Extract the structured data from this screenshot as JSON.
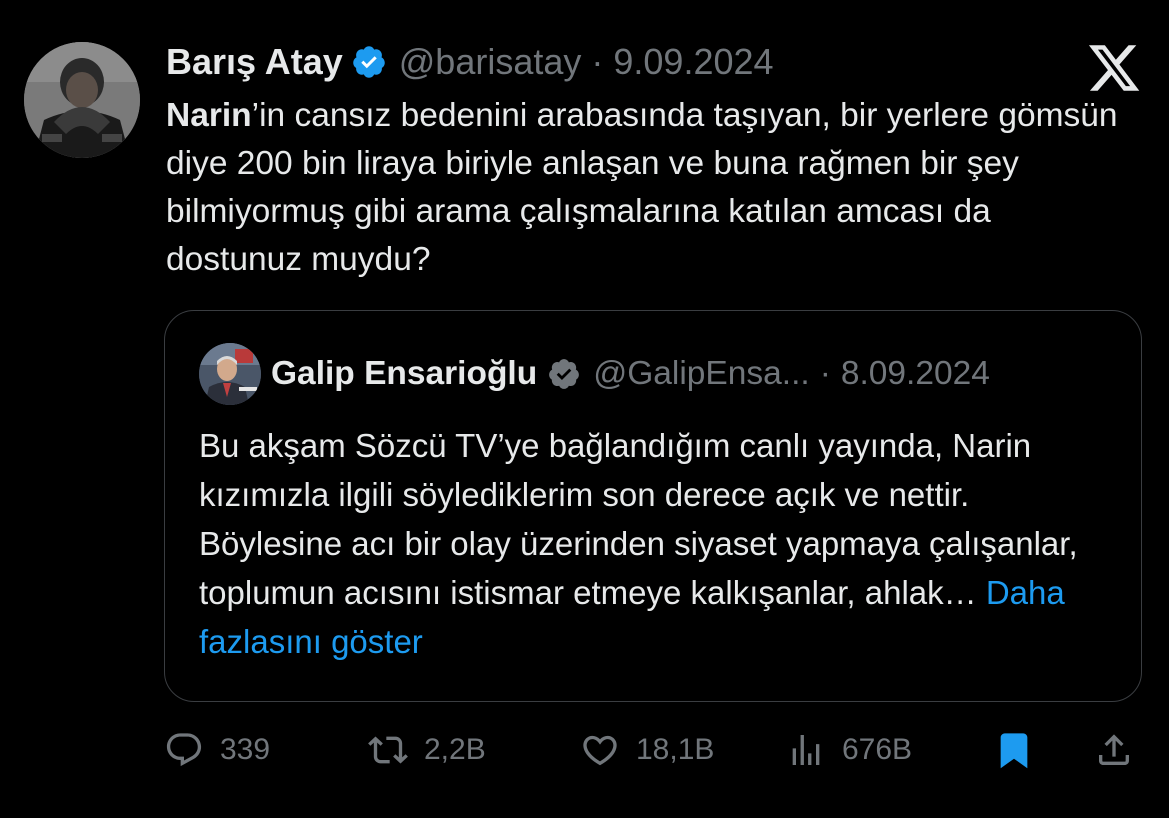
{
  "tweet": {
    "author_name": "Barış Atay",
    "handle": "@barisatay",
    "separator": "·",
    "date": "9.09.2024",
    "text_bold": "Narin",
    "text_rest": "’in cansız bedenini arabasında taşıyan, bir yerlere gömsün diye 200 bin liraya biriyle anlaşan ve buna rağmen bir şey bilmiyormuş gibi arama çalışmalarına katılan amcası da dostunuz muydu?"
  },
  "quote": {
    "author_name": "Galip Ensarioğlu",
    "handle": "@GalipEnsa...",
    "separator": "·",
    "date": "8.09.2024",
    "text": "Bu akşam Sözcü TV’ye bağlandığım canlı yayında, Narin kızımızla ilgili söylediklerim son derece açık ve nettir. Böylesine acı bir olay üzerinden siyaset yapmaya çalışanlar, toplumun acısını istismar etmeye kalkışanlar, ahlak… ",
    "more_link": "Daha fazlasını göster"
  },
  "actions": {
    "replies": "339",
    "reposts": "2,2B",
    "likes": "18,1B",
    "views": "676B"
  },
  "icons": {
    "reply": "reply-icon",
    "repost": "repost-icon",
    "like": "heart-icon",
    "views": "views-icon",
    "bookmark": "bookmark-icon",
    "share": "share-icon",
    "logo": "x-logo-icon",
    "verified": "verified-badge-icon"
  },
  "colors": {
    "background": "#000000",
    "text": "#e7e9ea",
    "secondary": "#71767b",
    "link": "#1d9bf0",
    "verified": "#1d9bf0",
    "bookmark_active": "#1d9bf0"
  }
}
